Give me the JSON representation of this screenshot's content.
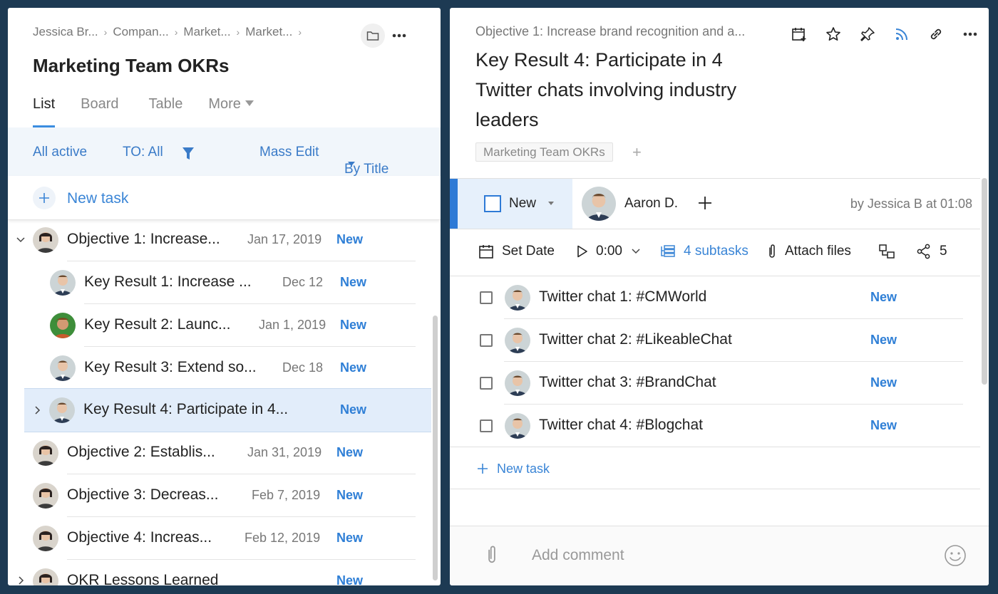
{
  "left_panel": {
    "breadcrumbs": [
      "Jessica Br...",
      "Compan...",
      "Market...",
      "Market..."
    ],
    "title": "Marketing Team OKRs",
    "tabs": [
      {
        "label": "List",
        "active": true
      },
      {
        "label": "Board",
        "active": false
      },
      {
        "label": "Table",
        "active": false
      },
      {
        "label": "More",
        "active": false
      }
    ],
    "filters": {
      "active": "All active",
      "to": "TO: All",
      "mass_edit": "Mass Edit",
      "sort": "By Title"
    },
    "new_task_label": "New task",
    "tasks": [
      {
        "title": "Objective 1: Increase...",
        "date": "Jan 17, 2019",
        "status": "New",
        "level": 0,
        "chevron": "down"
      },
      {
        "title": "Key Result 1: Increase ...",
        "date": "Dec 12",
        "status": "New",
        "level": 1,
        "chevron": ""
      },
      {
        "title": "Key Result 2: Launc...",
        "date": "Jan 1, 2019",
        "status": "New",
        "level": 1,
        "chevron": ""
      },
      {
        "title": "Key Result 3: Extend so...",
        "date": "Dec 18",
        "status": "New",
        "level": 1,
        "chevron": ""
      },
      {
        "title": "Key Result 4: Participate in  4...",
        "date": "",
        "status": "New",
        "level": 1,
        "chevron": "right",
        "selected": true
      },
      {
        "title": "Objective 2: Establis...",
        "date": "Jan 31, 2019",
        "status": "New",
        "level": 0,
        "chevron": ""
      },
      {
        "title": "Objective 3: Decreas...",
        "date": "Feb 7, 2019",
        "status": "New",
        "level": 0,
        "chevron": ""
      },
      {
        "title": "Objective 4: Increas...",
        "date": "Feb 12, 2019",
        "status": "New",
        "level": 0,
        "chevron": ""
      },
      {
        "title": "OKR Lessons Learned",
        "date": "",
        "status": "New",
        "level": 0,
        "chevron": "right"
      }
    ]
  },
  "right_panel": {
    "parent": "Objective 1: Increase brand recognition and a...",
    "title": "Key Result 4: Participate in 4 Twitter chats involving industry leaders",
    "tag": "Marketing Team OKRs",
    "status": "New",
    "assignee": "Aaron D.",
    "byline": "by Jessica B at 01:08",
    "toolbar": {
      "set_date": "Set Date",
      "time": "0:00",
      "subtasks": "4 subtasks",
      "attach": "Attach files",
      "shares": "5"
    },
    "subtasks": [
      {
        "title": "Twitter chat 1: #CMWorld",
        "status": "New"
      },
      {
        "title": "Twitter chat 2: #LikeableChat",
        "status": "New"
      },
      {
        "title": "Twitter chat 3: #BrandChat",
        "status": "New"
      },
      {
        "title": "Twitter chat 4: #Blogchat",
        "status": "New"
      }
    ],
    "new_subtask_label": "New task",
    "comment_placeholder": "Add comment"
  },
  "colors": {
    "background": "#1d3a53",
    "accent": "#3a85d6",
    "selected_row": "#e2edfa",
    "filterbar": "#f1f6fb"
  }
}
